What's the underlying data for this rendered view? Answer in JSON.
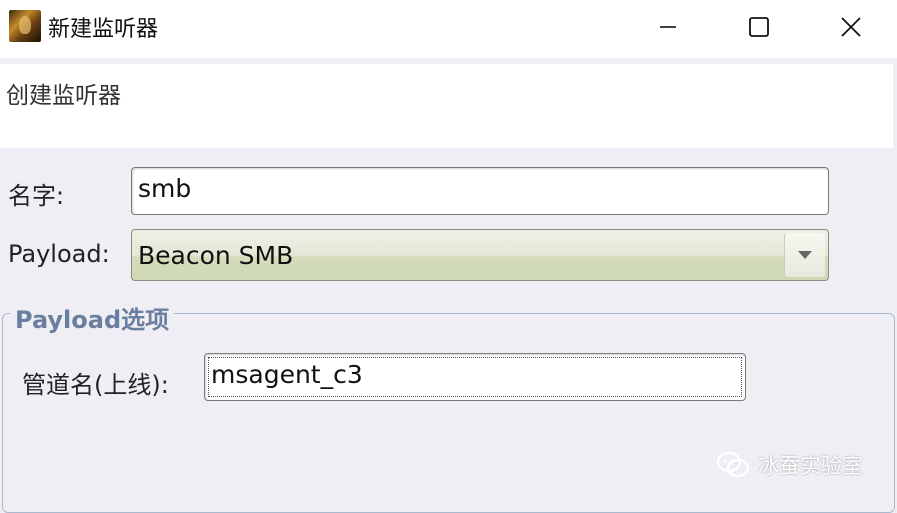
{
  "window": {
    "title": "新建监听器",
    "icon": "app-icon"
  },
  "header": {
    "text": "创建监听器"
  },
  "form": {
    "name_label": "名字:",
    "name_value": "smb",
    "payload_label": "Payload:",
    "payload_value": "Beacon SMB",
    "payload_dropdown_icon": "chevron-down-icon"
  },
  "payload_options": {
    "group_title": "Payload选项",
    "pipe_label": "管道名(上线):",
    "pipe_value": "msagent_c3"
  },
  "watermark": {
    "text": "冰蚕实验室",
    "icon": "wechat-icon"
  },
  "colors": {
    "group_title": "#6a7f9f",
    "combo_bg": "#dfe4cf",
    "window_bg": "#eeeef4"
  }
}
